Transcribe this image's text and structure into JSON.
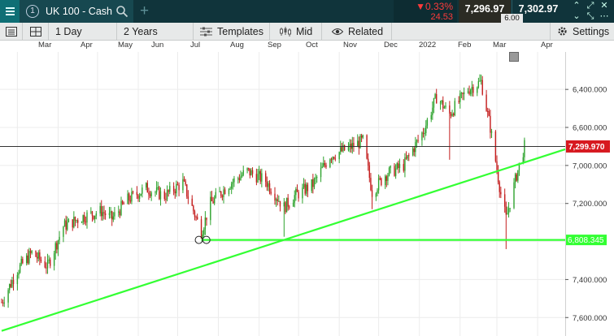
{
  "instrument_tab": {
    "number": "1",
    "title": "UK 100 - Cash"
  },
  "quote": {
    "change_pct": "▼0.33%",
    "change_abs": "24.53",
    "sell": "7,296.97",
    "buy": "7,302.97",
    "spread": "6.00"
  },
  "toolbar": {
    "interval": "1 Day",
    "range": "2 Years",
    "templates": "Templates",
    "price_mode": "Mid",
    "related": "Related",
    "settings": "Settings"
  },
  "axis": {
    "months": [
      "Mar",
      "Apr",
      "May",
      "Jun",
      "Jul",
      "Aug",
      "Sep",
      "Oct",
      "Nov",
      "Dec",
      "2022",
      "Feb",
      "Mar",
      "Apr"
    ],
    "price_ticks": [
      "7,600.000",
      "7,400.000",
      "7,200.000",
      "7,000.000",
      "6,600.000",
      "6,400.000"
    ]
  },
  "tags": {
    "current_price": "7,299.970",
    "horizontal_line": "6,808.345"
  },
  "colors": {
    "header_bg": "#10343b",
    "bull": "#2ea32e",
    "bear": "#c41e1e",
    "trendline": "#33ff33",
    "price_tag": "#d71920"
  },
  "chart_data": {
    "type": "candlestick",
    "ylim": [
      6320,
      7780
    ],
    "price_ticks": [
      6400,
      6600,
      7000,
      7200,
      7400,
      7600
    ],
    "current_price": 7299.97,
    "horizontal_level": 6808.345,
    "trendline": {
      "from": [
        "2021-02-17",
        6330
      ],
      "to": [
        "2022-04-22",
        7285
      ]
    },
    "anchors": [
      "2021-07-19",
      "2021-07-21"
    ],
    "path": [
      [
        "2021-02-17",
        6480
      ],
      [
        "2021-03-01",
        6650
      ],
      [
        "2021-03-12",
        6740
      ],
      [
        "2021-03-24",
        6670
      ],
      [
        "2021-04-05",
        6880
      ],
      [
        "2021-04-20",
        6930
      ],
      [
        "2021-05-04",
        6960
      ],
      [
        "2021-05-12",
        6920
      ],
      [
        "2021-05-24",
        7020
      ],
      [
        "2021-06-07",
        7080
      ],
      [
        "2021-06-21",
        7040
      ],
      [
        "2021-07-05",
        7110
      ],
      [
        "2021-07-19",
        6850
      ],
      [
        "2021-07-26",
        7000
      ],
      [
        "2021-08-09",
        7100
      ],
      [
        "2021-08-23",
        7170
      ],
      [
        "2021-09-06",
        7120
      ],
      [
        "2021-09-20",
        6980
      ],
      [
        "2021-09-28",
        7040
      ],
      [
        "2021-10-12",
        7100
      ],
      [
        "2021-10-25",
        7250
      ],
      [
        "2021-11-08",
        7290
      ],
      [
        "2021-11-19",
        7330
      ],
      [
        "2021-11-26",
        7060
      ],
      [
        "2021-12-06",
        7150
      ],
      [
        "2021-12-20",
        7200
      ],
      [
        "2022-01-04",
        7380
      ],
      [
        "2022-01-14",
        7560
      ],
      [
        "2022-01-24",
        7470
      ],
      [
        "2022-02-07",
        7600
      ],
      [
        "2022-02-17",
        7640
      ],
      [
        "2022-02-24",
        7400
      ],
      [
        "2022-03-04",
        7050
      ],
      [
        "2022-03-08",
        6920
      ],
      [
        "2022-03-16",
        7150
      ],
      [
        "2022-03-22",
        7300
      ]
    ],
    "spikes": [
      [
        "2021-04-14",
        6880
      ],
      [
        "2021-07-19",
        6820
      ],
      [
        "2021-09-20",
        6825
      ],
      [
        "2021-11-26",
        6970
      ],
      [
        "2022-01-24",
        7230
      ],
      [
        "2022-03-08",
        6760
      ]
    ]
  }
}
